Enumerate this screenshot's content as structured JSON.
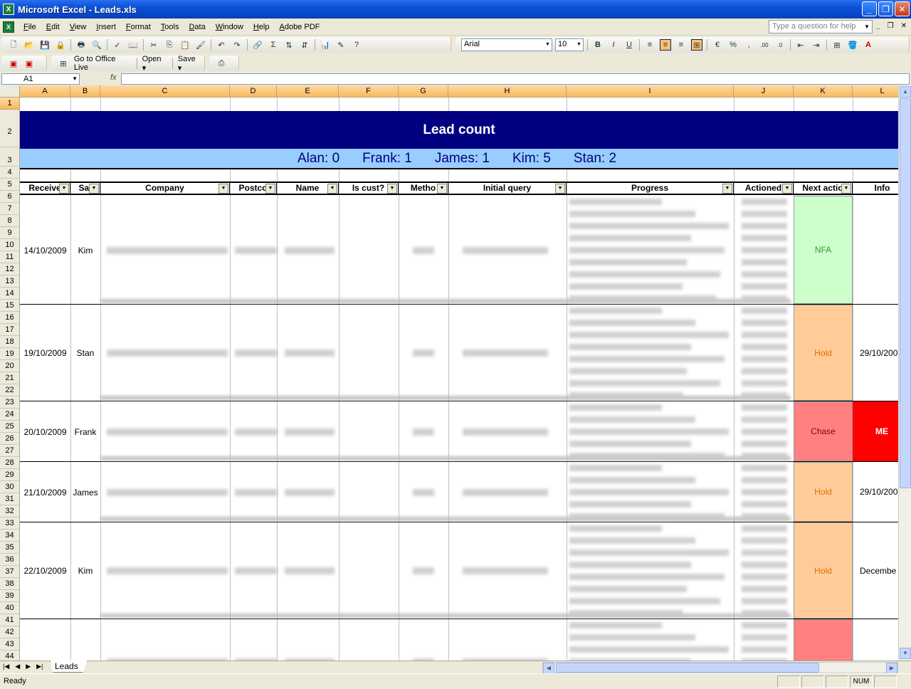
{
  "window": {
    "title": "Microsoft Excel - Leads.xls",
    "app_icon": "X"
  },
  "menu": [
    "File",
    "Edit",
    "View",
    "Insert",
    "Format",
    "Tools",
    "Data",
    "Window",
    "Help",
    "Adobe PDF"
  ],
  "help_placeholder": "Type a question for help",
  "toolbar": {
    "font": "Arial",
    "size": "10",
    "office_live": "Go to Office Live",
    "open": "Open",
    "save": "Save"
  },
  "formula": {
    "cell_ref": "A1",
    "fx": "fx"
  },
  "columns": [
    "A",
    "B",
    "C",
    "D",
    "E",
    "F",
    "G",
    "H",
    "I",
    "J",
    "K",
    "L"
  ],
  "title": "Lead count",
  "summary": {
    "alan": "Alan: 0",
    "frank": "Frank: 1",
    "james": "James: 1",
    "kim": "Kim: 5",
    "stan": "Stan: 2"
  },
  "headers": [
    "Receive",
    "Sal",
    "Company",
    "Postco",
    "Name",
    "Is cust?",
    "Metho",
    "Initial query",
    "Progress",
    "Actioned",
    "Next actio",
    "Info"
  ],
  "records": [
    {
      "received": "14/10/2009",
      "sales": "Kim",
      "next": "NFA",
      "info": ""
    },
    {
      "received": "19/10/2009",
      "sales": "Stan",
      "next": "Hold",
      "info": "29/10/200"
    },
    {
      "received": "20/10/2009",
      "sales": "Frank",
      "next": "Chase",
      "info": "ME"
    },
    {
      "received": "21/10/2009",
      "sales": "James",
      "next": "Hold",
      "info": "29/10/200"
    },
    {
      "received": "22/10/2009",
      "sales": "Kim",
      "next": "Hold",
      "info": "Decembe"
    },
    {
      "received": "",
      "sales": "",
      "next": "",
      "info": ""
    }
  ],
  "colors": {
    "title_bg": "#000080",
    "summary_bg": "#99ccff",
    "nfa_bg": "#ccffcc",
    "hold_bg": "#ffcc99",
    "chase_bg": "#ff8080",
    "me_bg": "#ff0000"
  },
  "sheet_tab": "Leads",
  "status": {
    "left": "Ready",
    "num": "NUM"
  }
}
